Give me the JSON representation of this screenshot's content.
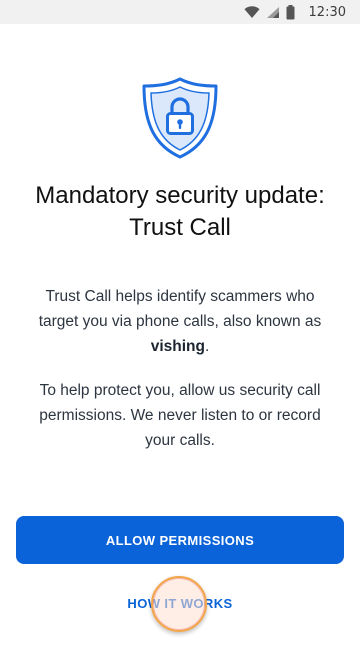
{
  "status_bar": {
    "time": "12:30",
    "icons": [
      "wifi-icon",
      "cellular-signal-icon",
      "battery-icon"
    ]
  },
  "hero": {
    "icon": "shield-lock-icon",
    "title_line1": "Mandatory security update:",
    "title_line2": "Trust Call"
  },
  "body": {
    "para1_text": "Trust Call helps identify scammers who target you via phone calls, also known as ",
    "para1_bold": "vishing",
    "para1_end": ".",
    "para2_text": "To help protect you, allow us security call permissions. We never listen to or record your calls."
  },
  "actions": {
    "allow_label": "ALLOW PERMISSIONS",
    "how_label": "HOW IT WORKS"
  },
  "colors": {
    "primary": "#0a63d8",
    "shield_light": "#dbe8fb",
    "status_bar_bg": "#f1f1f1"
  }
}
